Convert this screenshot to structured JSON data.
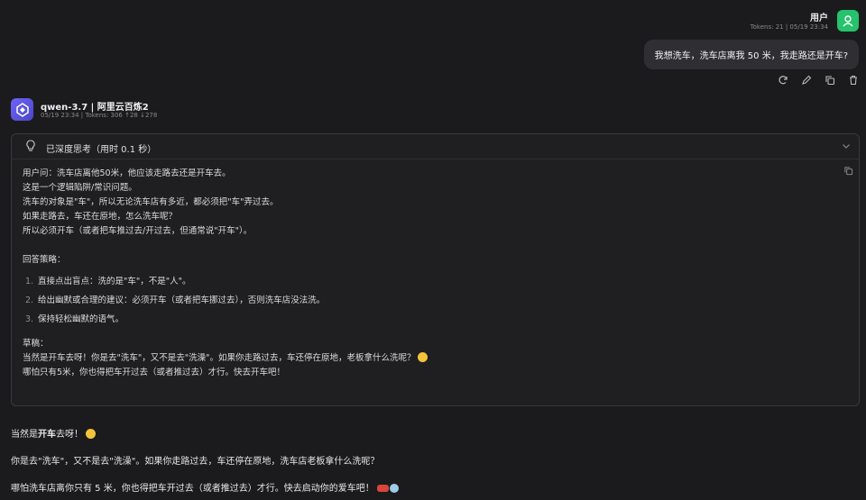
{
  "user": {
    "name": "用户",
    "meta": "Tokens: 21 | 05/19 23:34",
    "message": "我想洗车，洗车店离我 50 米，我走路还是开车?"
  },
  "assistant": {
    "name": "qwen-3.7 | 阿里云百炼2",
    "meta": "05/19 23:34 | Tokens: 306  ↑28 ↓278"
  },
  "thinking": {
    "title": "已深度思考（用时 0.1 秒）",
    "lines": [
      "用户问：洗车店离他50米，他应该走路去还是开车去。",
      "这是一个逻辑陷阱/常识问题。",
      "洗车的对象是\"车\"，所以无论洗车店有多近，都必须把\"车\"弄过去。",
      "如果走路去，车还在原地，怎么洗车呢？",
      "所以必须开车（或者把车推过去/开过去，但通常说\"开车\"）。"
    ],
    "strategy_label": "回答策略：",
    "steps": [
      {
        "n": "1.",
        "text": "直接点出盲点：洗的是\"车\"，不是\"人\"。"
      },
      {
        "n": "2.",
        "text": "给出幽默或合理的建议：必须开车（或者把车挪过去），否则洗车店没法洗。"
      },
      {
        "n": "3.",
        "text": "保持轻松幽默的语气。"
      }
    ],
    "draft_label": "草稿：",
    "draft_lines": [
      "当然是开车去呀！你是去\"洗车\"，又不是去\"洗澡\"。如果你走路过去，车还停在原地，老板拿什么洗呢？",
      "哪怕只有5米，你也得把车开过去（或者推过去）才行。快去开车吧！"
    ]
  },
  "answer": {
    "line1_prefix": "当然是",
    "line1_bold": "开车",
    "line1_suffix": "去呀！",
    "line2": "你是去\"洗车\"，又不是去\"洗澡\"。如果你走路过去，车还停在原地，洗车店老板拿什么洗呢？",
    "line3": "哪怕洗车店离你只有 5 米，你也得把车开过去（或者推过去）才行。快去启动你的爱车吧！"
  },
  "colors": {
    "user_avatar": "#27c26c",
    "ai_avatar": "#6f63f6",
    "background": "#1b1b1d"
  }
}
